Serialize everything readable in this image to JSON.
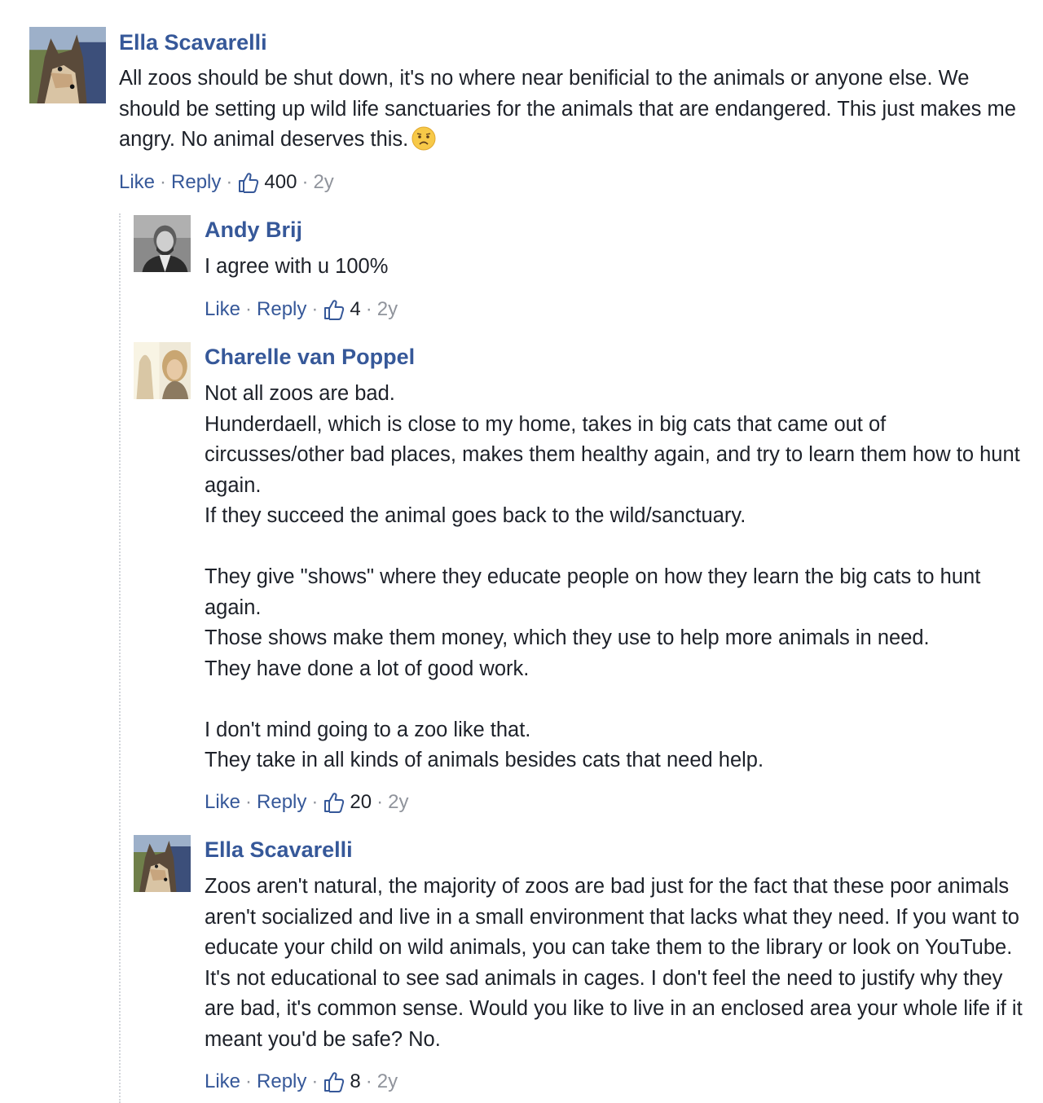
{
  "comments": [
    {
      "author": "Ella Scavarelli",
      "text": "All zoos should be shut down, it's no where near benificial to the animals or anyone else. We should be setting up wild life sanctuaries for the animals that are endangered. This just makes me angry. No animal deserves this.",
      "emoji": "worried-face-emoji",
      "like_label": "Like",
      "reply_label": "Reply",
      "likes": "400",
      "time": "2y"
    },
    {
      "author": "Andy Brij",
      "text": "I agree with u 100%",
      "like_label": "Like",
      "reply_label": "Reply",
      "likes": "4",
      "time": "2y"
    },
    {
      "author": "Charelle van Poppel",
      "text": "Not all zoos are bad.\nHunderdaell, which is close to my home, takes in big cats that came out of circusses/other bad places, makes them healthy again, and try to learn them how to hunt again.\nIf they succeed the animal goes back to the wild/sanctuary.\n\nThey give \"shows\" where they educate people on how they learn the big cats to hunt again.\nThose shows make them money, which they use to help more animals in need.\nThey have done a lot of good work.\n\nI don't mind going to a zoo like that.\nThey take in all kinds of animals besides cats that need help.",
      "like_label": "Like",
      "reply_label": "Reply",
      "likes": "20",
      "time": "2y"
    },
    {
      "author": "Ella Scavarelli",
      "text": "Zoos aren't natural, the majority of zoos are bad just for the fact that these poor animals aren't socialized and live in a small environment that lacks what they need. If you want to educate your child on wild animals, you can take them to the library or look on YouTube. It's not educational to see sad animals in cages. I don't feel the need to justify why they are bad, it's common sense. Would you like to live in an enclosed area your whole life if it meant you'd be safe? No.",
      "like_label": "Like",
      "reply_label": "Reply",
      "likes": "8",
      "time": "2y"
    }
  ],
  "separator": "·",
  "colors": {
    "link": "#365899",
    "text": "#1d2129",
    "muted": "#90949c"
  }
}
